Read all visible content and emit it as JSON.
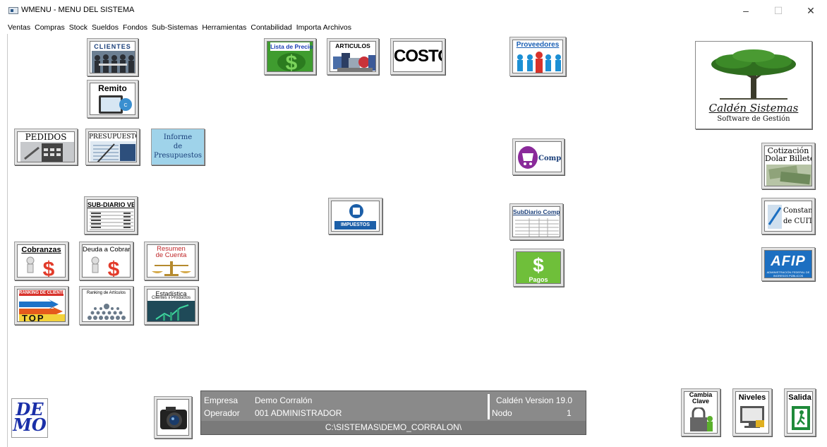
{
  "window": {
    "title": "WMENU - MENU DEL SISTEMA",
    "controls": {
      "minimize": "–",
      "maximize": "☐",
      "close": "✕"
    }
  },
  "menu": [
    "Ventas",
    "Compras",
    "Stock",
    "Sueldos",
    "Fondos",
    "Sub-Sistemas",
    "Herramientas",
    "Contabilidad",
    "Importa Archivos"
  ],
  "tiles": {
    "clientes": "CLIENTES",
    "remito": "Remito",
    "lista_precios": "Lista de Precios",
    "articulos": "ARTICULOS",
    "costos": "COSTOS",
    "proveedores": "Proveedores",
    "pedidos": "PEDIDOS",
    "presupuesto": "PRESUPUESTO",
    "informe_presupuestos": [
      "Informe",
      "de",
      "Presupuestos"
    ],
    "compras": "Compras",
    "sub_diario_ventas": "SUB-DIARIO VENTAS",
    "impuestos": "IMPUESTOS",
    "subdiario_compras": "SubDiario Compras",
    "cobranzas": "Cobranzas",
    "deuda_cobrar": "Deuda a Cobrar",
    "resumen_cuenta": [
      "Resumen",
      "de Cuenta"
    ],
    "pagos": "Pagos",
    "ranking_clientes": "RANKING DE CLIENTES",
    "ranking_clientes_top": "TOP",
    "ranking_articulos": "Ranking de Artículos",
    "estadistica": "Estadística",
    "estadistica_sub": "Clientes x Productos",
    "cotizacion": [
      "Cotización",
      "Dolar Billete"
    ],
    "constancia_cuit": [
      "Constancia",
      "de CUIT"
    ],
    "afip": "AFIP",
    "afip_sub": "ADMINISTRACIÓN FEDERAL DE INGRESOS PÚBLICOS",
    "cambia_clave": [
      "Cambia",
      "Clave"
    ],
    "niveles": "Niveles",
    "salida": "Salida"
  },
  "brand": {
    "name": "Caldén Sistemas",
    "tagline": "Software de Gestión",
    "demo": [
      "DE",
      "MO"
    ]
  },
  "status": {
    "empresa_label": "Empresa",
    "empresa_value": "Demo Corralón",
    "operador_label": "Operador",
    "operador_value": "001 ADMINISTRADOR",
    "version": "Caldén Version 19.0",
    "nodo_label": "Nodo",
    "nodo_value": "1",
    "path": "C:\\SISTEMAS\\DEMO_CORRALON\\"
  },
  "colors": {
    "accent_blue": "#1a5fb4",
    "money_green": "#3f9c2f",
    "status_gray": "#8a8a8a",
    "afip_blue": "#1c6fc1"
  }
}
